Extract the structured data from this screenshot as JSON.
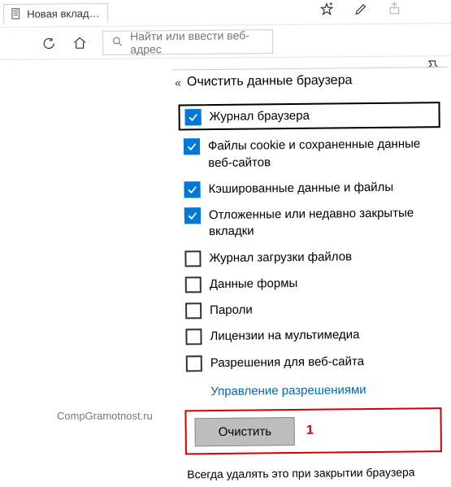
{
  "tab": {
    "title": "Новая вклад…"
  },
  "search": {
    "placeholder": "Найти или ввести веб-адрес"
  },
  "panel": {
    "title": "Очистить данные браузера",
    "items": [
      {
        "label": "Журнал браузера",
        "checked": true,
        "highlighted": true
      },
      {
        "label": "Файлы cookie и сохраненные данные веб-сайтов",
        "checked": true
      },
      {
        "label": "Кэшированные данные и файлы",
        "checked": true
      },
      {
        "label": "Отложенные или недавно закрытые вкладки",
        "checked": true
      },
      {
        "label": "Журнал загрузки файлов",
        "checked": false
      },
      {
        "label": "Данные формы",
        "checked": false
      },
      {
        "label": "Пароли",
        "checked": false
      },
      {
        "label": "Лицензии на мультимедиа",
        "checked": false
      },
      {
        "label": "Разрешения для веб-сайта",
        "checked": false
      }
    ],
    "permissions_link": "Управление разрешениями",
    "clear_button": "Очистить",
    "clear_annotation": "1",
    "footer": "Всегда удалять это при закрытии браузера"
  },
  "watermark": "CompGramotnost.ru"
}
